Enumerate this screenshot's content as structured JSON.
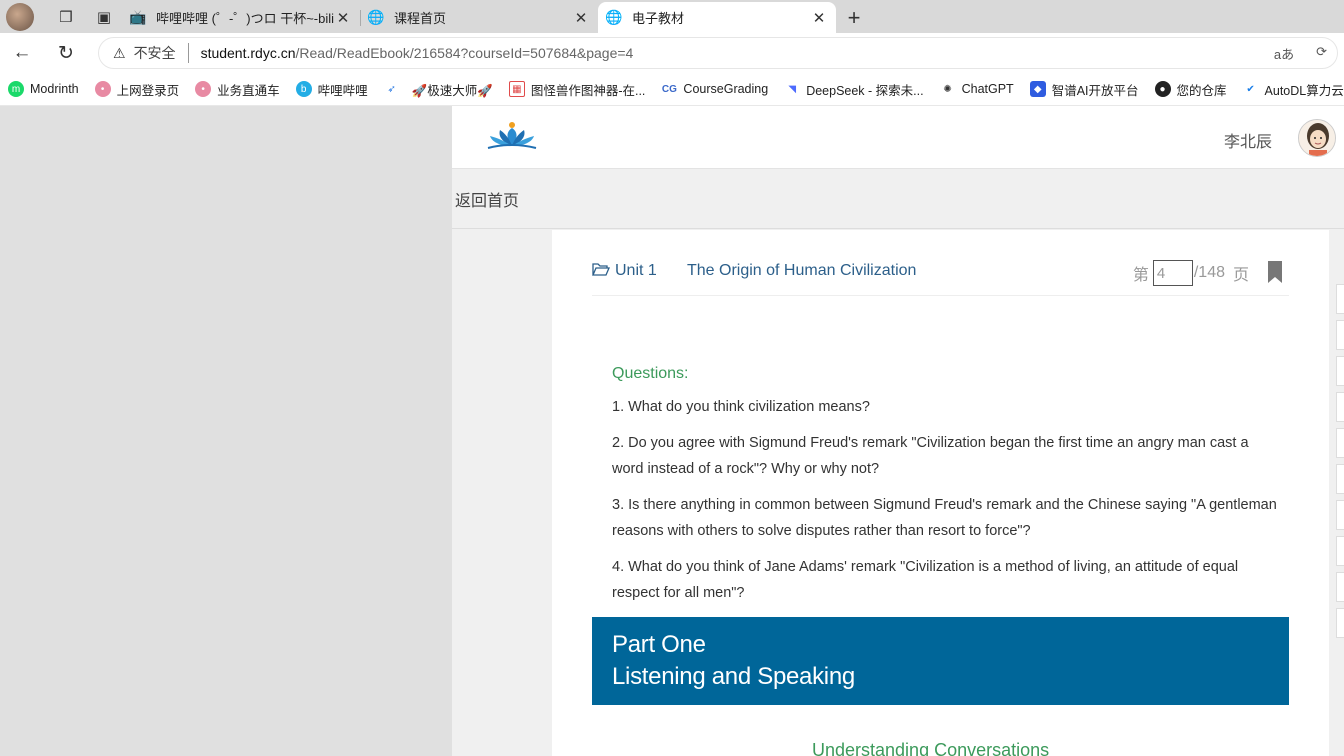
{
  "browser": {
    "tabs": [
      {
        "title": "哔哩哔哩 (゜-゜)つロ 干杯~-bilibili",
        "icon": "bilibili-icon"
      },
      {
        "title": "课程首页",
        "icon": "globe-icon"
      },
      {
        "title": "电子教材",
        "icon": "globe-icon",
        "active": true
      }
    ],
    "address": {
      "security_label": "不安全",
      "url_host": "student.rdyc.cn",
      "url_path": "/Read/ReadEbook/216584?courseId=507684&page=4"
    },
    "bookmarks": [
      {
        "label": "Modrinth",
        "color": "#1bd96a"
      },
      {
        "label": "上网登录页",
        "color": "#e88aa3"
      },
      {
        "label": "业务直通车",
        "color": "#e88aa3"
      },
      {
        "label": "哔哩哔哩",
        "color": "#23ade5"
      },
      {
        "label": "",
        "color": "#2a7ae2"
      },
      {
        "label": "🚀极速大师🚀",
        "color": ""
      },
      {
        "label": "图怪兽作图神器-在...",
        "color": "#e04b4b"
      },
      {
        "label": "CourseGrading",
        "color": "#3a68c9"
      },
      {
        "label": "DeepSeek - 探索未...",
        "color": "#4d6bfe"
      },
      {
        "label": "ChatGPT",
        "color": "#333333"
      },
      {
        "label": "智谱AI开放平台",
        "color": "#2f5ce0"
      },
      {
        "label": "您的仓库",
        "color": "#222222"
      },
      {
        "label": "AutoDL算力云 | 弹...",
        "color": "#1a7ee8"
      }
    ]
  },
  "site": {
    "username": "李北辰",
    "back_label": "返回首页"
  },
  "reader": {
    "unit_no": "Unit 1",
    "unit_title": "The Origin of Human Civilization",
    "page_prefix": "第",
    "page_value": "4",
    "page_total": "/148",
    "page_suffix": "页",
    "questions_heading": "Questions:",
    "questions": [
      "1. What do you think civilization means?",
      "2. Do you agree with Sigmund Freud's remark \"Civilization began the first time an angry man cast a word instead of a rock\"? Why or why not?",
      "3. Is there anything in common between Sigmund Freud's remark and the Chinese saying \"A gentleman reasons with others to solve disputes rather than resort to force\"?",
      "4. What do you think of Jane Adams' remark \"Civilization is a method of living, an attitude of equal respect for all men\"?"
    ],
    "part_line1": "Part One",
    "part_line2": "Listening and Speaking",
    "subheading": "Understanding Conversations"
  },
  "colors": {
    "banner": "#006699",
    "heading_green": "#3c9a5b",
    "unit_blue": "#2c5f8a"
  }
}
